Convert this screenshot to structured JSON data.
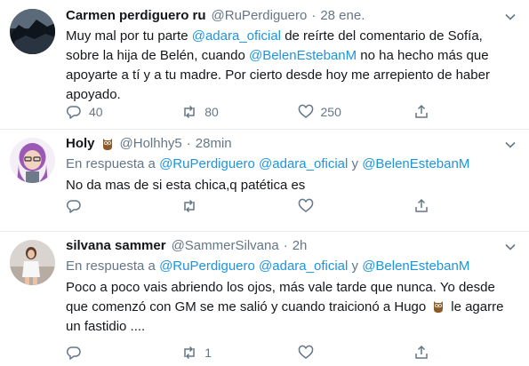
{
  "tweets": [
    {
      "name": "Carmen perdiguero ru",
      "handle": "@RuPerdiguero",
      "separator": "·",
      "time": "28 ene.",
      "text_parts": [
        "Muy mal por tu parte ",
        "@adara_oficial",
        " de reírte del comentario de Sofía, sobre la hija de Belén, cuando ",
        "@BelenEstebanM",
        " no ha hecho más que apoyarte a tí y a tu madre. Por cierto desde hoy me arrepiento de haber apoyado."
      ],
      "counts": {
        "replies": "40",
        "retweets": "80",
        "likes": "250"
      }
    },
    {
      "name": "Holy",
      "name_emoji": "owl-emoji",
      "handle": "@Holhhy5",
      "separator": "·",
      "time": "28min",
      "reply_prefix": "En respuesta a ",
      "reply_mention_1": "@RuPerdiguero",
      "reply_mention_2": "@adara_oficial",
      "reply_and": " y ",
      "reply_mention_3": "@BelenEstebanM",
      "text": "No da mas de si esta chica,q patética es",
      "counts": {
        "replies": "",
        "retweets": "",
        "likes": ""
      }
    },
    {
      "name": "silvana sammer",
      "handle": "@SammerSilvana",
      "separator": "·",
      "time": "2h",
      "reply_prefix": "En respuesta a ",
      "reply_mention_1": "@RuPerdiguero",
      "reply_mention_2": "@adara_oficial",
      "reply_and": " y ",
      "reply_mention_3": "@BelenEstebanM",
      "text_part_1": "Poco a poco vais  abriendo los ojos, más vale tarde que nunca. Yo desde que comenzó con GM se me salió y cuando traicionó a Hugo",
      "text_emoji": "owl-emoji",
      "text_part_2": "le agarre un fastidio ....",
      "counts": {
        "replies": "",
        "retweets": "1",
        "likes": ""
      }
    }
  ],
  "colors": {
    "link": "#1b95e0",
    "muted": "#657786",
    "text": "#14171a",
    "divider": "#e6ecf0"
  }
}
